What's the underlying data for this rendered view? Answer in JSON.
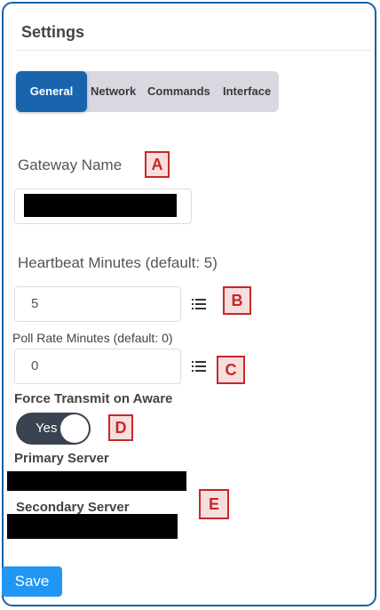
{
  "panel": {
    "title": "Settings"
  },
  "tabs": [
    {
      "label": "General",
      "active": true
    },
    {
      "label": "Network",
      "active": false
    },
    {
      "label": "Commands",
      "active": false
    },
    {
      "label": "Interface",
      "active": false
    }
  ],
  "fields": {
    "gateway_name": {
      "label": "Gateway Name",
      "value": ""
    },
    "heartbeat": {
      "label": "Heartbeat Minutes (default: 5)",
      "value": "5"
    },
    "poll_rate": {
      "label": "Poll Rate Minutes (default: 0)",
      "value": "0"
    },
    "force_transmit": {
      "label": "Force Transmit on Aware",
      "toggle_label": "Yes",
      "on": true
    },
    "primary_server": {
      "label": "Primary Server"
    },
    "secondary_server": {
      "label": "Secondary Server"
    }
  },
  "markers": [
    "A",
    "B",
    "C",
    "D",
    "E"
  ],
  "icons": {
    "list": "list-icon"
  },
  "colors": {
    "accent": "#1a64ae",
    "save": "#2196f3",
    "marker": "#c62828",
    "frame": "#1a5fa8"
  },
  "save_label": "Save"
}
